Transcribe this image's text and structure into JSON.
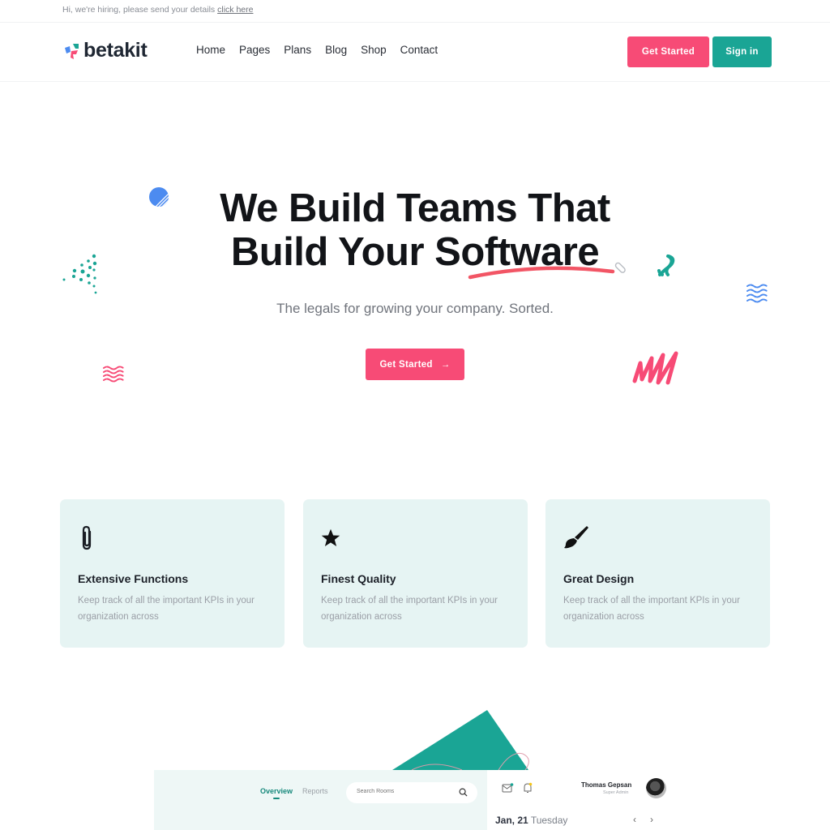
{
  "topbar": {
    "text": "Hi, we're hiring, please send your details",
    "link": "click here"
  },
  "brand": {
    "name": "betakit",
    "colors": {
      "pink": "#f74b76",
      "teal": "#1aa595",
      "blue": "#4c8bf0",
      "dark": "#1f2733"
    }
  },
  "nav": {
    "items": [
      {
        "label": "Home"
      },
      {
        "label": "Pages"
      },
      {
        "label": "Plans"
      },
      {
        "label": "Blog"
      },
      {
        "label": "Shop"
      },
      {
        "label": "Contact"
      }
    ],
    "get_started": "Get Started",
    "sign_in": "Sign in"
  },
  "hero": {
    "title_line1": "We Build Teams That",
    "title_line2_prefix": "Build Your ",
    "title_highlight": "Software",
    "subtitle": "The legals for growing your company. Sorted.",
    "cta": "Get Started",
    "cta_icon": "arrow-right-icon",
    "cta_arrow": "→"
  },
  "features": [
    {
      "icon": "paperclip-icon",
      "title": "Extensive Functions",
      "desc": "Keep track of all the important KPIs in your organization across"
    },
    {
      "icon": "star-icon",
      "title": "Finest Quality",
      "desc": "Keep track of all the important KPIs in your organization across"
    },
    {
      "icon": "paintbrush-icon",
      "title": "Great Design",
      "desc": "Keep track of all the important KPIs in your organization across"
    }
  ],
  "dashboard": {
    "tabs": [
      {
        "label": "Overview",
        "active": true
      },
      {
        "label": "Reports",
        "active": false
      }
    ],
    "search_placeholder": "Search Rooms",
    "user_name": "Thomas Gepsan",
    "user_role": "Super Admin",
    "date_day": "Jan, 21",
    "date_weekday": "Tuesday",
    "prev": "‹",
    "next": "›"
  }
}
